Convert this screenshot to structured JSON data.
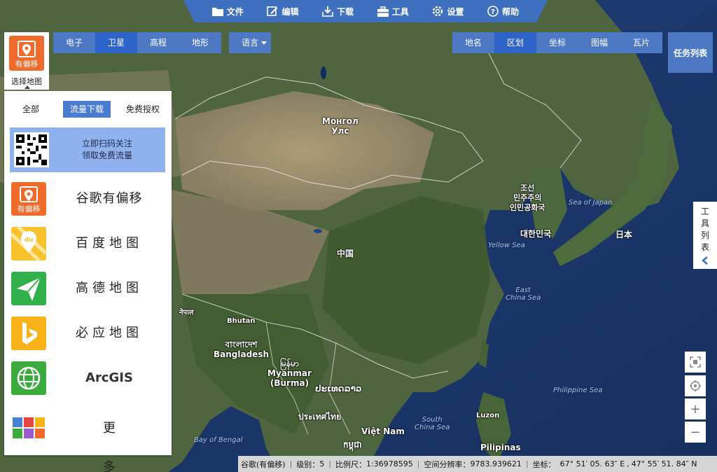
{
  "top_menu": [
    {
      "id": "file",
      "label": "文件",
      "icon": "folder-icon"
    },
    {
      "id": "edit",
      "label": "编辑",
      "icon": "edit-icon"
    },
    {
      "id": "download",
      "label": "下载",
      "icon": "download-icon"
    },
    {
      "id": "tools",
      "label": "工具",
      "icon": "toolbox-icon"
    },
    {
      "id": "settings",
      "label": "设置",
      "icon": "gear-icon"
    },
    {
      "id": "help",
      "label": "帮助",
      "icon": "help-icon"
    }
  ],
  "map_types": {
    "items": [
      "电子",
      "卫星",
      "高程",
      "地形"
    ],
    "active": "卫星"
  },
  "language": {
    "label": "语言"
  },
  "overlay_types": {
    "items": [
      "地名",
      "区划",
      "坐标",
      "图幅",
      "瓦片"
    ],
    "active": "区划"
  },
  "task_list": {
    "label": "任务列表"
  },
  "source_selector": {
    "icon_text": "有偏移",
    "label": "选择地图"
  },
  "source_panel": {
    "tabs": [
      "全部",
      "流量下载",
      "免费授权"
    ],
    "active_tab": "流量下载",
    "promo": {
      "line1": "立即扫码关注",
      "line2": "领取免费流量"
    },
    "items": [
      {
        "name": "谷歌有偏移",
        "icon": "google-offset-icon",
        "icon_text": "有偏移"
      },
      {
        "name": "百度地图",
        "icon": "baidu-map-icon",
        "icon_text": "du"
      },
      {
        "name": "高德地图",
        "icon": "amap-icon"
      },
      {
        "name": "必应地图",
        "icon": "bing-icon"
      },
      {
        "name": "ArcGIS",
        "icon": "arcgis-icon"
      },
      {
        "name": "更多",
        "icon": "more-grid-icon"
      }
    ]
  },
  "tool_list": {
    "label": "工具列表"
  },
  "map_controls": {
    "fit": "fullscreen-icon",
    "locate": "locate-icon",
    "zoom_in": "+",
    "zoom_out": "−"
  },
  "map_labels": {
    "mongolia": "Монгол\nУлс",
    "china": "中国",
    "north_korea": "조선\n민주주의\n인민공화국",
    "south_korea": "대한민국",
    "japan": "日本",
    "nepal": "नेपाल",
    "bhutan": "Bhutan",
    "bangladesh": "বাংলাদেশ\nBangladesh",
    "myanmar": "မြန်မာ\nMyanmar\n(Burma)",
    "laos": "ປະເທດລາວ",
    "thailand": "ประเทศไทย",
    "vietnam": "Việt Nam",
    "cambodia": "កម្ពុជា",
    "luzon": "Luzon",
    "philippines": "Pilipinas"
  },
  "sea_labels": {
    "sea_of_japan": "Sea of Japan",
    "yellow_sea": "Yellow Sea",
    "east_china_sea": "East\nChina Sea",
    "south_china_sea": "South\nChina Sea",
    "philippine_sea": "Philippine Sea",
    "bay_of_bengal": "Bay of Bengal"
  },
  "status_bar": {
    "source": "谷歌(有偏移)",
    "level_label": "级别：",
    "level": "5",
    "scale_label": "比例尺：",
    "scale": "1:36978595",
    "resolution_label": "空间分辨率：",
    "resolution": "9783.939621",
    "coord_label": "坐标：",
    "longitude": "67° 51′ 05. 63″ E",
    "latitude": "47° 55′ 51. 84″ N"
  },
  "colors": {
    "accent": "#4a7dd0",
    "bar": "#3f6fbf",
    "ocean": "#1b3a73"
  }
}
